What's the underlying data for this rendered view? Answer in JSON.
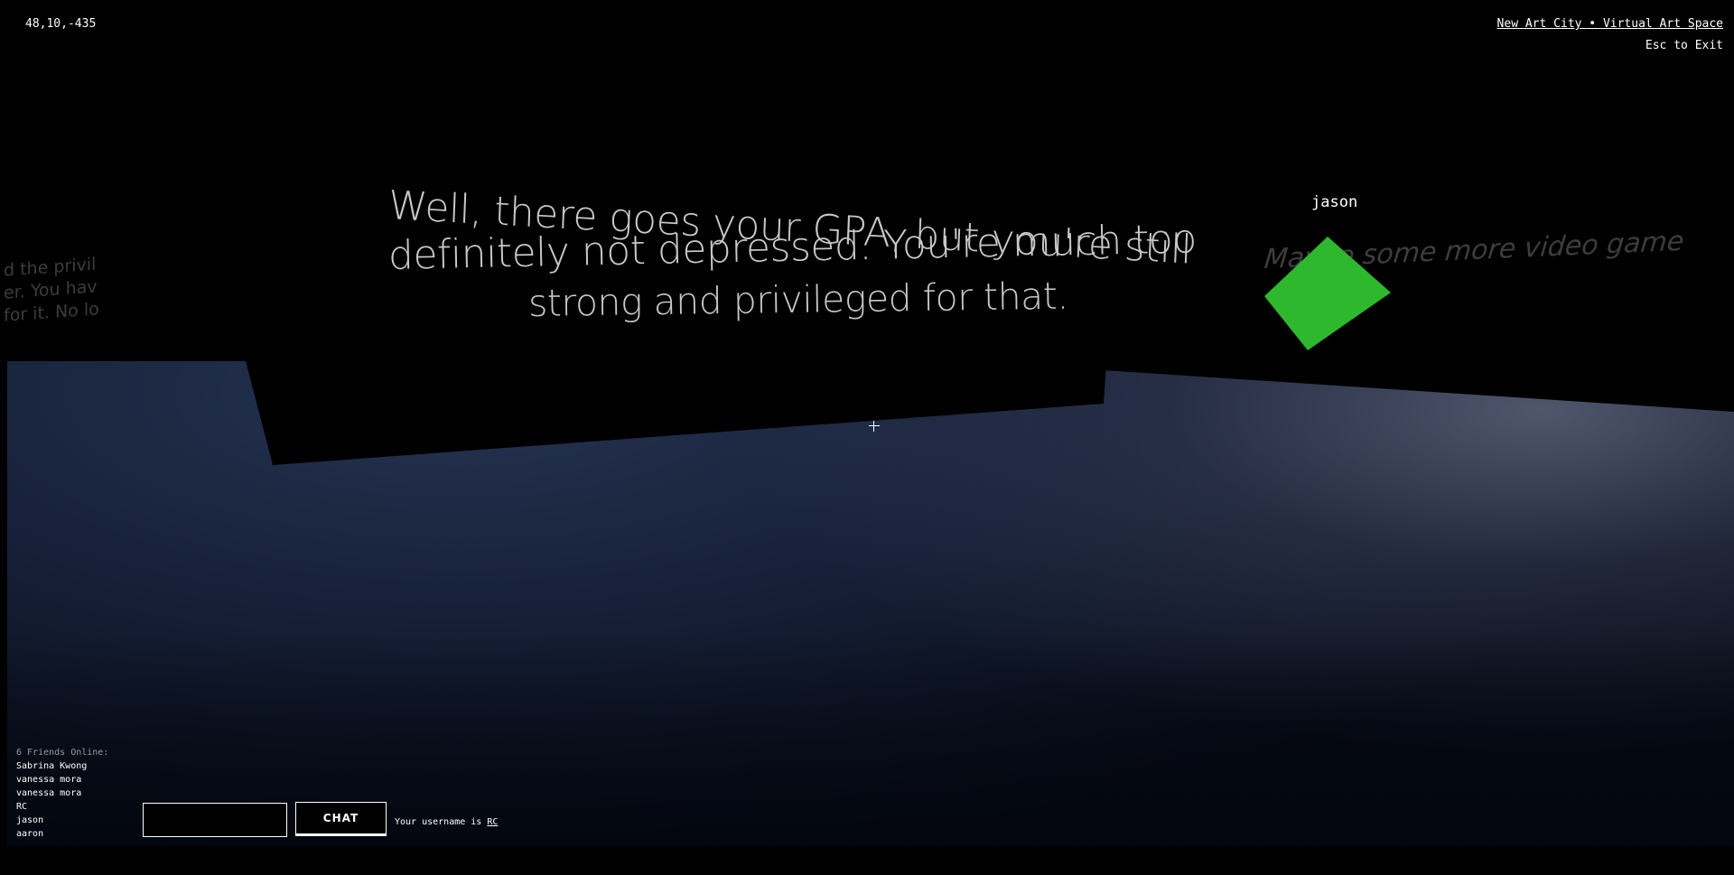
{
  "hud": {
    "coordinates": "48,10,-435",
    "site_title": "New Art City • Virtual Art Space",
    "exit_hint": "Esc to Exit"
  },
  "scene": {
    "quote_lines": [
      "Well, there goes your GPA, but you're still",
      "definitely not depressed. You're much too",
      "strong and privileged for that."
    ],
    "side_wall_text": [
      "d the privil",
      "er. You hav",
      "for it. No lo"
    ],
    "right_wall_text": "Maybe some more video game",
    "avatar_name": "jason",
    "avatar_color": "#2db82d",
    "floor_color": "#1b2742"
  },
  "friends": {
    "title": "6 Friends Online:",
    "list": [
      "Sabrina Kwong",
      "vanessa mora",
      "vanessa mora",
      "RC",
      "jason",
      "aaron"
    ]
  },
  "chat": {
    "input_value": "",
    "button_label": "CHAT",
    "username_prefix": "Your username is ",
    "username": "RC"
  }
}
